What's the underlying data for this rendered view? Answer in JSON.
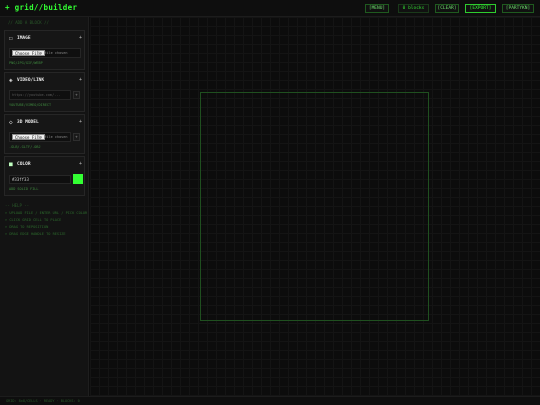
{
  "header": {
    "logo_mark": "+",
    "title": "grid//builder",
    "buttons": {
      "menu": "[MENU]",
      "blocks": "0 blocks",
      "clear": "[CLEAR]",
      "export": "[EXPORT]",
      "share": "[PARTYKN]"
    }
  },
  "sidebar": {
    "heading": "// ADD A BLOCK //",
    "panels": {
      "image": {
        "icon": "square-icon",
        "title": "IMAGE",
        "add": "+",
        "file_button": "Choose File",
        "file_status": "No file chosen",
        "hint": "PNG/JPG/GIF/WEBP"
      },
      "video": {
        "icon": "play-diamond-icon",
        "title": "VIDEO/LINK",
        "add": "+",
        "url_placeholder": "https://youtube.com/...",
        "go": "+",
        "hint": "YOUTUBE/VIMEO/DIRECT"
      },
      "model": {
        "icon": "diamond-icon",
        "title": "3D MODEL",
        "add": "+",
        "file_button": "Choose File",
        "file_status": "No file chosen",
        "go": "+",
        "hint": ".GLB/.GLTF/.OBJ"
      },
      "color": {
        "icon": "filled-square-icon",
        "title": "COLOR",
        "add": "+",
        "hex": "#33ff33",
        "swatch_color": "#33ff33",
        "hint": "ADD SOLID FILL"
      }
    },
    "help": {
      "title": "-- HELP --",
      "lines": [
        "> UPLOAD FILE / ENTER URL / PICK COLOR",
        "> CLICK GRID CELL TO PLACE",
        "> DRAG TO REPOSITION",
        "> DRAG EDGE HANDLE TO RESIZE"
      ]
    }
  },
  "canvas": {
    "frame_color": "#1f4f1f"
  },
  "statusbar": {
    "text": "GRID: 8x8/CELLS · READY · BLOCKS: 0"
  },
  "colors": {
    "accent": "#33ff33",
    "background": "#0c0c0c",
    "panel": "#161616"
  }
}
